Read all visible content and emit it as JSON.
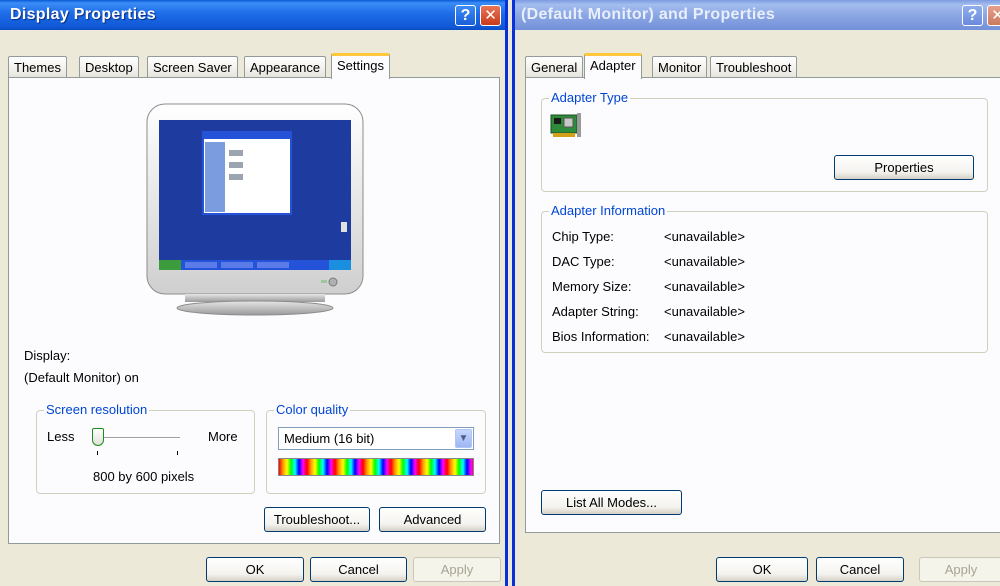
{
  "left_window": {
    "title": "Display Properties",
    "help_icon": "?",
    "close_icon": "✕",
    "tabs": [
      "Themes",
      "Desktop",
      "Screen Saver",
      "Appearance",
      "Settings"
    ],
    "display_label": "Display:",
    "display_value": "(Default Monitor) on",
    "screen_resolution": {
      "label": "Screen resolution",
      "less": "Less",
      "more": "More",
      "value": "800 by 600 pixels",
      "slider_position": 0.0
    },
    "color_quality": {
      "label": "Color quality",
      "selected": "Medium (16 bit)"
    },
    "troubleshoot_button": "Troubleshoot...",
    "advanced_button": "Advanced",
    "ok_button": "OK",
    "cancel_button": "Cancel",
    "apply_button": "Apply"
  },
  "right_window": {
    "title": "(Default Monitor) and  Properties",
    "help_icon": "?",
    "close_icon": "✕",
    "tabs": [
      "General",
      "Adapter",
      "Monitor",
      "Troubleshoot"
    ],
    "adapter_type_label": "Adapter Type",
    "properties_button": "Properties",
    "adapter_info_label": "Adapter Information",
    "info_rows": [
      {
        "label": "Chip Type:",
        "value": "<unavailable>"
      },
      {
        "label": "DAC Type:",
        "value": "<unavailable>"
      },
      {
        "label": "Memory Size:",
        "value": "<unavailable>"
      },
      {
        "label": "Adapter String:",
        "value": "<unavailable>"
      },
      {
        "label": "Bios Information:",
        "value": "<unavailable>"
      }
    ],
    "list_all_modes_button": "List All Modes...",
    "ok_button": "OK",
    "cancel_button": "Cancel",
    "apply_button": "Apply"
  },
  "colors": {
    "titlebar_active": "#0A5BD6",
    "titlebar_inactive": "#7C9BE0",
    "group_label": "#0046D5",
    "active_tab_highlight": "#FFC83C",
    "desktop_blue": "#1E3CA0"
  }
}
